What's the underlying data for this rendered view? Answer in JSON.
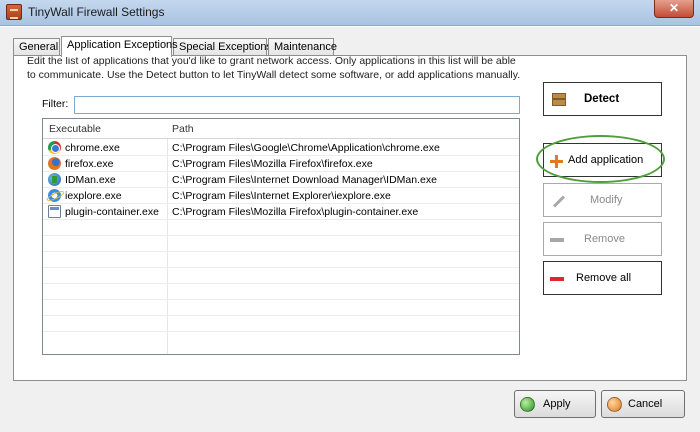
{
  "window": {
    "title": "TinyWall Firewall Settings",
    "close_glyph": "✕"
  },
  "tabs": [
    {
      "label": "General",
      "active": false
    },
    {
      "label": "Application Exceptions",
      "active": true
    },
    {
      "label": "Special Exceptions",
      "active": false
    },
    {
      "label": "Maintenance",
      "active": false
    }
  ],
  "description": "Edit the list of applications that you'd like to grant network access. Only applications in this list will be able to communicate. Use the Detect button to let TinyWall detect some software, or add applications manually.",
  "filter": {
    "label": "Filter:",
    "value": ""
  },
  "table": {
    "columns": [
      "Executable",
      "Path"
    ],
    "rows": [
      {
        "icon": "chrome-icon",
        "executable": "chrome.exe",
        "path": "C:\\Program Files\\Google\\Chrome\\Application\\chrome.exe"
      },
      {
        "icon": "firefox-icon",
        "executable": "firefox.exe",
        "path": "C:\\Program Files\\Mozilla Firefox\\firefox.exe"
      },
      {
        "icon": "idm-icon",
        "executable": "IDMan.exe",
        "path": "C:\\Program Files\\Internet Download Manager\\IDMan.exe"
      },
      {
        "icon": "internet-explorer-icon",
        "executable": "iexplore.exe",
        "path": "C:\\Program Files\\Internet Explorer\\iexplore.exe"
      },
      {
        "icon": "plugin-container-icon",
        "executable": "plugin-container.exe",
        "path": "C:\\Program Files\\Mozilla Firefox\\plugin-container.exe"
      }
    ]
  },
  "side_buttons": {
    "detect": "Detect",
    "add_application": "Add application",
    "modify": "Modify",
    "remove": "Remove",
    "remove_all": "Remove all"
  },
  "footer": {
    "apply": "Apply",
    "cancel": "Cancel"
  },
  "colors": {
    "highlight_ring": "#4f9e3c",
    "add_icon": "#e07d1a",
    "remove_all_icon": "#e2262a"
  }
}
